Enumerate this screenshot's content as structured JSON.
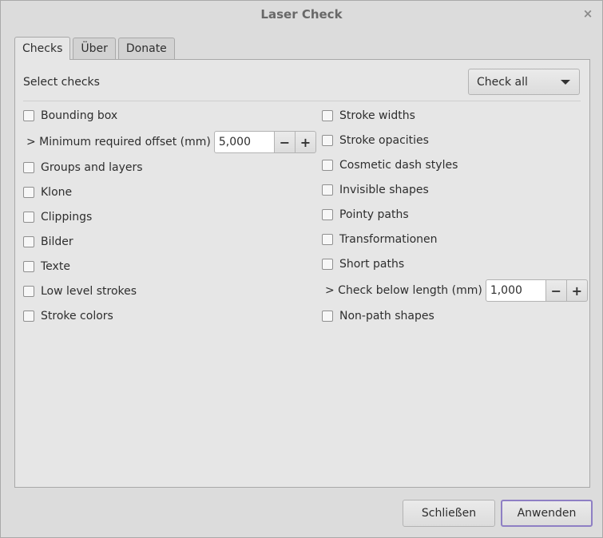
{
  "window": {
    "title": "Laser Check"
  },
  "tabs": [
    {
      "label": "Checks"
    },
    {
      "label": "Über"
    },
    {
      "label": "Donate"
    }
  ],
  "header": {
    "select_label": "Select checks",
    "dropdown_value": "Check all"
  },
  "left_checks": [
    {
      "label": "Bounding box"
    },
    {
      "label": "Groups and layers"
    },
    {
      "label": "Klone"
    },
    {
      "label": "Clippings"
    },
    {
      "label": "Bilder"
    },
    {
      "label": "Texte"
    },
    {
      "label": "Low level strokes"
    },
    {
      "label": "Stroke colors"
    }
  ],
  "min_offset": {
    "label": "> Minimum required offset (mm)",
    "value": "5,000"
  },
  "right_checks": [
    {
      "label": "Stroke widths"
    },
    {
      "label": "Stroke opacities"
    },
    {
      "label": "Cosmetic dash styles"
    },
    {
      "label": "Invisible shapes"
    },
    {
      "label": "Pointy paths"
    },
    {
      "label": "Transformationen"
    },
    {
      "label": "Short paths"
    },
    {
      "label": "Non-path shapes"
    }
  ],
  "below_length": {
    "label": "> Check below length (mm)",
    "value": "1,000"
  },
  "spin": {
    "minus": "−",
    "plus": "+"
  },
  "footer": {
    "close_label": "Schließen",
    "apply_label": "Anwenden"
  },
  "icons": {
    "close": "×"
  }
}
